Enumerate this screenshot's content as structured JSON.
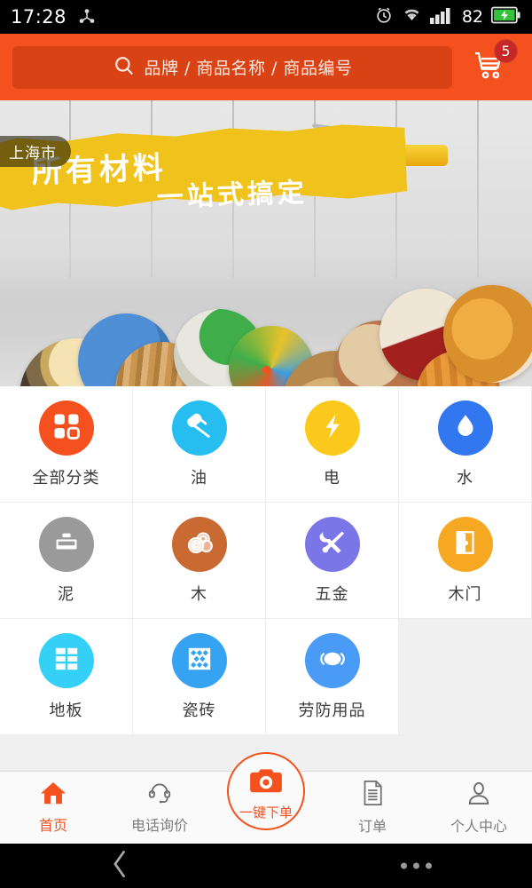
{
  "statusbar": {
    "time": "17:28",
    "battery_percent": "82",
    "icons": [
      "share-nodes-icon",
      "alarm-clock-icon",
      "wifi-icon",
      "cellular-signal-icon",
      "battery-charging-icon"
    ]
  },
  "header": {
    "search_placeholder": "品牌 / 商品名称 / 商品编号",
    "search_icon": "search-icon",
    "cart_icon": "shopping-cart-icon",
    "cart_badge": "5",
    "background_color": "#f4511e",
    "search_field_color": "#d94215"
  },
  "banner": {
    "location_label": "上海市",
    "headline_line1": "所有材料",
    "headline_line2": "一站式搞定",
    "stroke_color": "#efc31c",
    "carousel_dots": 1,
    "active_dot_index": 0,
    "active_dot_color": "#f4511e"
  },
  "categories": [
    {
      "label": "全部分类",
      "icon": "grid-squares-icon",
      "color": "#f4511e"
    },
    {
      "label": "油",
      "icon": "paint-roller-icon",
      "color": "#26bdf0"
    },
    {
      "label": "电",
      "icon": "lightning-bolt-icon",
      "color": "#fbc91b"
    },
    {
      "label": "水",
      "icon": "water-drop-icon",
      "color": "#3277f0"
    },
    {
      "label": "泥",
      "icon": "trowel-icon",
      "color": "#9a9a9a"
    },
    {
      "label": "木",
      "icon": "wood-log-icon",
      "color": "#c86a32"
    },
    {
      "label": "五金",
      "icon": "tools-wrench-icon",
      "color": "#7b76e8"
    },
    {
      "label": "木门",
      "icon": "door-icon",
      "color": "#f7a823"
    },
    {
      "label": "地板",
      "icon": "floor-tiles-icon",
      "color": "#35d0f5"
    },
    {
      "label": "瓷砖",
      "icon": "ceramic-tile-icon",
      "color": "#35a3f2"
    },
    {
      "label": "劳防用品",
      "icon": "face-mask-icon",
      "color": "#4a9bf5"
    }
  ],
  "tabbar": {
    "items": [
      {
        "label": "首页",
        "icon": "home-icon",
        "active": true
      },
      {
        "label": "电话询价",
        "icon": "headset-icon",
        "active": false
      },
      {
        "label": "一键下单",
        "icon": "camera-icon",
        "active": true
      },
      {
        "label": "订单",
        "icon": "document-icon",
        "active": false
      },
      {
        "label": "个人中心",
        "icon": "person-icon",
        "active": false
      }
    ],
    "accent_color": "#f4511e"
  },
  "android_nav": {
    "back_icon": "chevron-left-icon",
    "menu_icon": "more-dots-icon"
  }
}
